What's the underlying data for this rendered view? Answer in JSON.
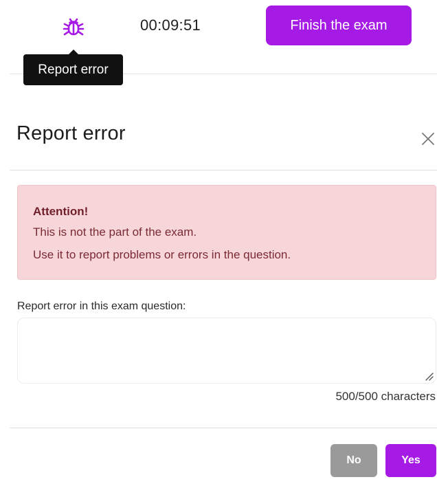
{
  "topbar": {
    "timer": "00:09:51",
    "finish_label": "Finish the exam",
    "tooltip": "Report error",
    "bug_icon": "bug-icon",
    "accent_color": "#a61ae6"
  },
  "modal": {
    "title": "Report error",
    "close_icon": "close-icon",
    "alert": {
      "title": "Attention!",
      "line1": "This is not the part of the exam.",
      "line2": "Use it to report problems or errors in the question.",
      "background_color": "#f7d6da",
      "text_color": "#7a2a32"
    },
    "field_label": "Report error in this exam question:",
    "textarea_value": "",
    "char_count": "500/500 characters",
    "no_label": "No",
    "yes_label": "Yes",
    "no_color": "#9a9a9a",
    "yes_color": "#a61ae6"
  }
}
